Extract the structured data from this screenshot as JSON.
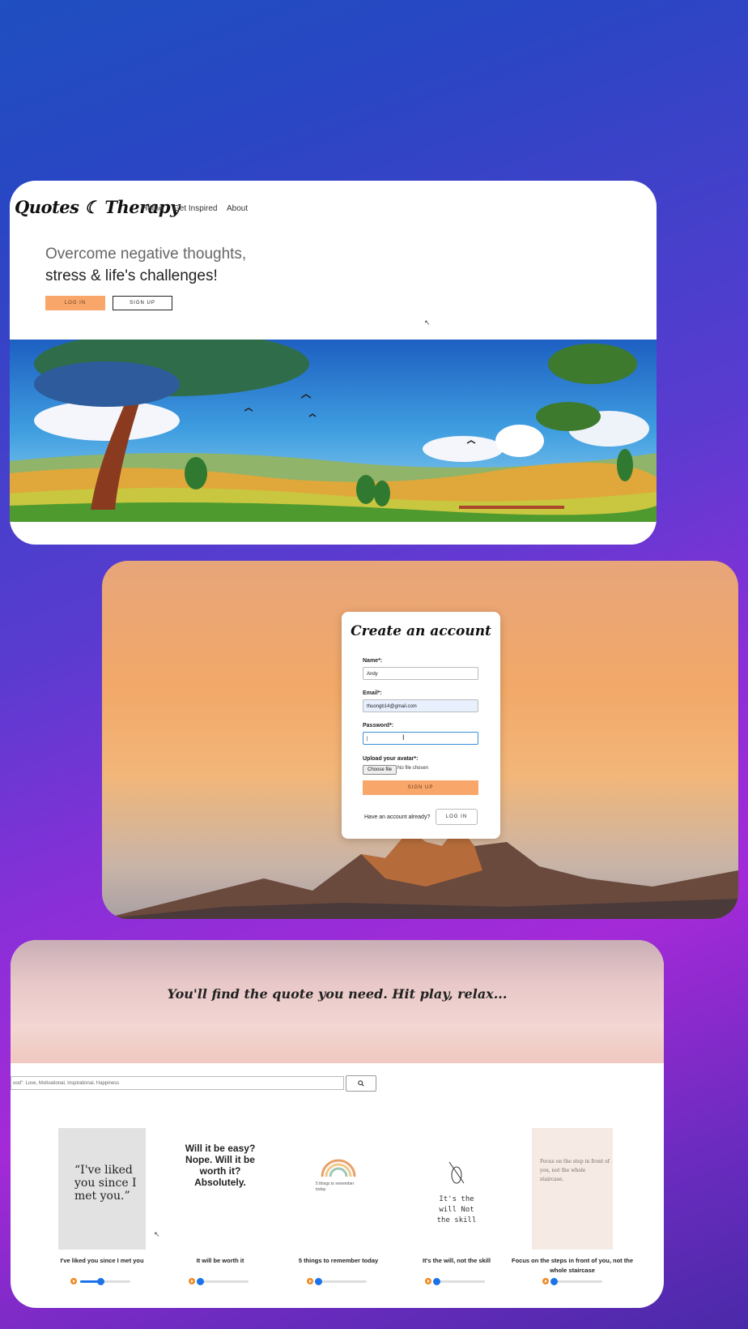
{
  "landing": {
    "logo": "Quotes ☾ Therapy",
    "nav": [
      "Home",
      "Get Inspired",
      "About"
    ],
    "headline_1": "Overcome negative thoughts,",
    "headline_2": "stress & life's challenges!",
    "login_label": "LOG IN",
    "signup_label": "SIGN UP"
  },
  "signup_form": {
    "title": "Create an account",
    "name_label": "Name*:",
    "name_value": "Andy",
    "email_label": "Email*:",
    "email_value": "thuongb14@gmail.com",
    "password_label": "Password*:",
    "avatar_label": "Upload your avatar*:",
    "choose_file": "Choose file",
    "no_file": "No file chosen",
    "submit_label": "SIGN UP",
    "have_account": "Have an account already?",
    "login_label": "LOG IN"
  },
  "quotes_page": {
    "title": "You'll find the quote you need. Hit play, relax...",
    "search_placeholder": "ood\": Love, Motivational, Inspirational, Happiness",
    "search_icon": "search-icon",
    "quotes": [
      {
        "title": "I've liked you since I met you",
        "card_text": "“I've liked you since I met you.”",
        "progress": 0.4
      },
      {
        "title": "It will be worth it",
        "card_text": "Will it be easy? Nope. Will it be worth it? Absolutely.",
        "progress": 0.03
      },
      {
        "title": "5 things to remember today",
        "card_text": "5 things to remember today",
        "progress": 0.03
      },
      {
        "title": "It's the will, not the skill",
        "card_text": "It's the will Not the skill",
        "progress": 0.03
      },
      {
        "title": "Focus on the steps in front of you, not the whole staircase",
        "card_text": "Focus on the step in front of you, not the whole staircase.",
        "progress": 0.03
      }
    ]
  },
  "colors": {
    "accent": "#f8a66a",
    "slider": "#1a73e8",
    "play": "#f08a24"
  }
}
